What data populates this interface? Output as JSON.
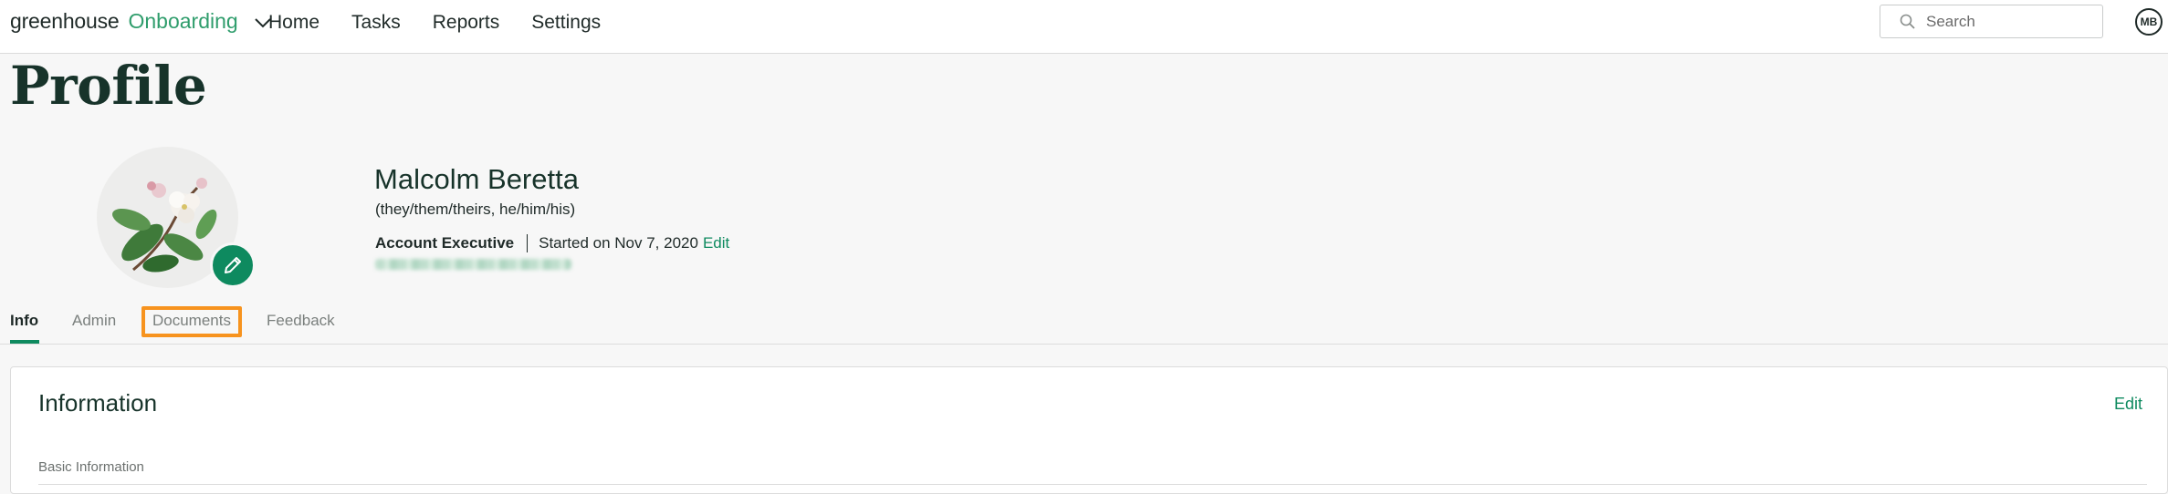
{
  "topbar": {
    "brand_word": "greenhouse",
    "brand_product": "Onboarding",
    "nav": [
      "Home",
      "Tasks",
      "Reports",
      "Settings"
    ],
    "search_placeholder": "Search",
    "user_initials": "MB"
  },
  "page": {
    "title": "Profile"
  },
  "profile": {
    "name": "Malcolm Beretta",
    "pronouns": "(they/them/theirs, he/him/his)",
    "job_title": "Account Executive",
    "start_text": "Started on Nov 7, 2020",
    "edit_label": "Edit"
  },
  "tabs": {
    "items": [
      "Info",
      "Admin",
      "Documents",
      "Feedback"
    ],
    "active": "Info",
    "highlighted": "Documents"
  },
  "card": {
    "title": "Information",
    "edit_label": "Edit",
    "section_label": "Basic Information"
  },
  "colors": {
    "brand_green": "#0e8a5f",
    "highlight_orange": "#f7931e"
  }
}
